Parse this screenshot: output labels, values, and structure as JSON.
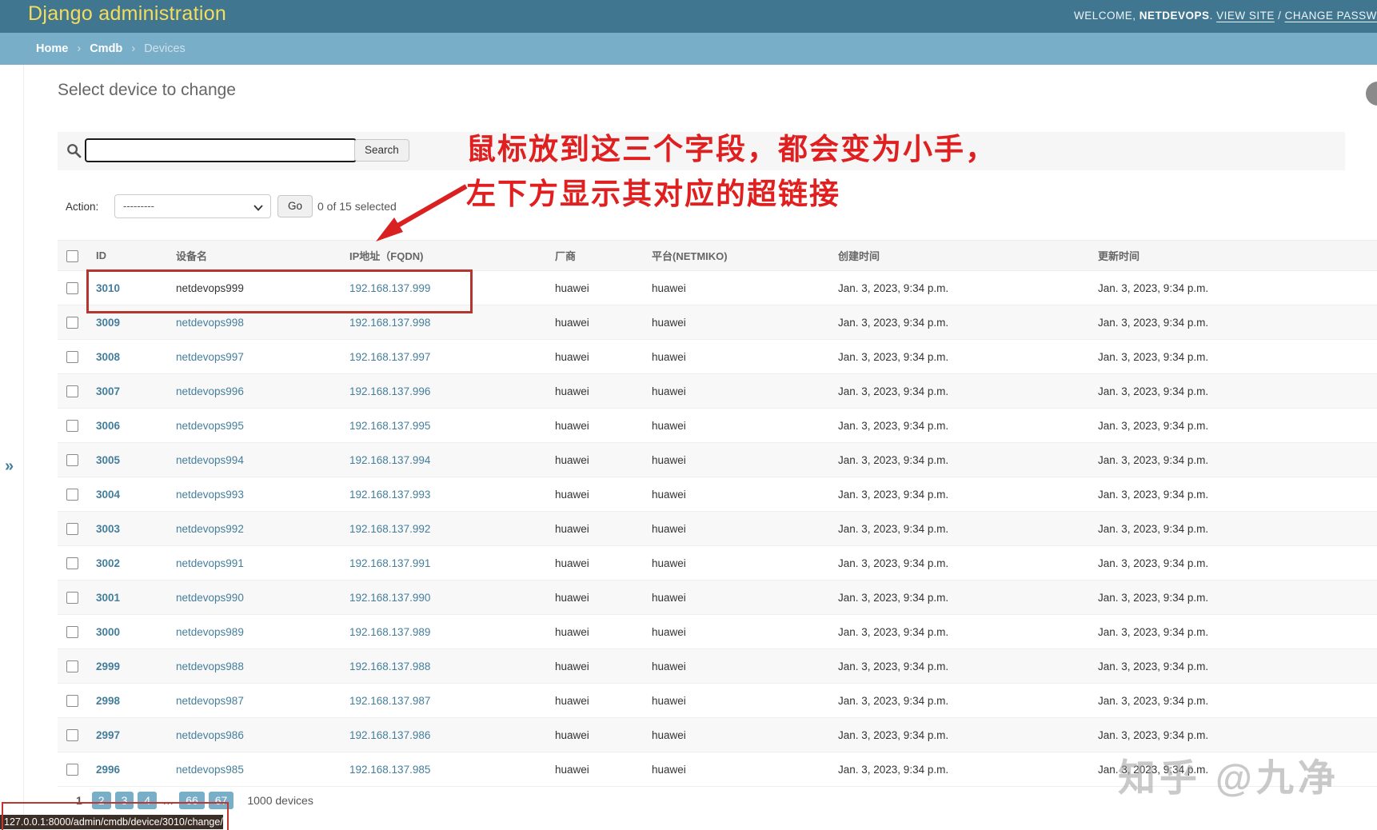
{
  "header": {
    "site_title": "Django administration",
    "welcome_text": "WELCOME,",
    "username": "NETDEVOPS",
    "after_username": ".",
    "view_site_link": "VIEW SITE",
    "link_separator": "/",
    "change_password_link": "CHANGE PASSWORD"
  },
  "breadcrumb": {
    "home": "Home",
    "cmdb": "Cmdb",
    "current": "Devices",
    "separator": "›"
  },
  "page_title": "Select device to change",
  "search": {
    "value": "",
    "placeholder": "",
    "button_label": "Search"
  },
  "actions": {
    "label": "Action:",
    "selected_option": "---------",
    "go_label": "Go",
    "selection_status": "0 of 15 selected"
  },
  "annotation": {
    "line1": "鼠标放到这三个字段，都会变为小手，",
    "line2": "左下方显示其对应的超链接"
  },
  "table": {
    "columns": {
      "id": "ID",
      "name": "设备名",
      "ip": "IP地址（FQDN)",
      "vendor": "厂商",
      "platform": "平台(NETMIKO)",
      "created": "创建时间",
      "updated": "更新时间"
    },
    "rows": [
      {
        "id": "3010",
        "name": "netdevops999",
        "ip": "192.168.137.999",
        "vendor": "huawei",
        "platform": "huawei",
        "created": "Jan. 3, 2023, 9:34 p.m.",
        "updated": "Jan. 3, 2023, 9:34 p.m."
      },
      {
        "id": "3009",
        "name": "netdevops998",
        "ip": "192.168.137.998",
        "vendor": "huawei",
        "platform": "huawei",
        "created": "Jan. 3, 2023, 9:34 p.m.",
        "updated": "Jan. 3, 2023, 9:34 p.m."
      },
      {
        "id": "3008",
        "name": "netdevops997",
        "ip": "192.168.137.997",
        "vendor": "huawei",
        "platform": "huawei",
        "created": "Jan. 3, 2023, 9:34 p.m.",
        "updated": "Jan. 3, 2023, 9:34 p.m."
      },
      {
        "id": "3007",
        "name": "netdevops996",
        "ip": "192.168.137.996",
        "vendor": "huawei",
        "platform": "huawei",
        "created": "Jan. 3, 2023, 9:34 p.m.",
        "updated": "Jan. 3, 2023, 9:34 p.m."
      },
      {
        "id": "3006",
        "name": "netdevops995",
        "ip": "192.168.137.995",
        "vendor": "huawei",
        "platform": "huawei",
        "created": "Jan. 3, 2023, 9:34 p.m.",
        "updated": "Jan. 3, 2023, 9:34 p.m."
      },
      {
        "id": "3005",
        "name": "netdevops994",
        "ip": "192.168.137.994",
        "vendor": "huawei",
        "platform": "huawei",
        "created": "Jan. 3, 2023, 9:34 p.m.",
        "updated": "Jan. 3, 2023, 9:34 p.m."
      },
      {
        "id": "3004",
        "name": "netdevops993",
        "ip": "192.168.137.993",
        "vendor": "huawei",
        "platform": "huawei",
        "created": "Jan. 3, 2023, 9:34 p.m.",
        "updated": "Jan. 3, 2023, 9:34 p.m."
      },
      {
        "id": "3003",
        "name": "netdevops992",
        "ip": "192.168.137.992",
        "vendor": "huawei",
        "platform": "huawei",
        "created": "Jan. 3, 2023, 9:34 p.m.",
        "updated": "Jan. 3, 2023, 9:34 p.m."
      },
      {
        "id": "3002",
        "name": "netdevops991",
        "ip": "192.168.137.991",
        "vendor": "huawei",
        "platform": "huawei",
        "created": "Jan. 3, 2023, 9:34 p.m.",
        "updated": "Jan. 3, 2023, 9:34 p.m."
      },
      {
        "id": "3001",
        "name": "netdevops990",
        "ip": "192.168.137.990",
        "vendor": "huawei",
        "platform": "huawei",
        "created": "Jan. 3, 2023, 9:34 p.m.",
        "updated": "Jan. 3, 2023, 9:34 p.m."
      },
      {
        "id": "3000",
        "name": "netdevops989",
        "ip": "192.168.137.989",
        "vendor": "huawei",
        "platform": "huawei",
        "created": "Jan. 3, 2023, 9:34 p.m.",
        "updated": "Jan. 3, 2023, 9:34 p.m."
      },
      {
        "id": "2999",
        "name": "netdevops988",
        "ip": "192.168.137.988",
        "vendor": "huawei",
        "platform": "huawei",
        "created": "Jan. 3, 2023, 9:34 p.m.",
        "updated": "Jan. 3, 2023, 9:34 p.m."
      },
      {
        "id": "2998",
        "name": "netdevops987",
        "ip": "192.168.137.987",
        "vendor": "huawei",
        "platform": "huawei",
        "created": "Jan. 3, 2023, 9:34 p.m.",
        "updated": "Jan. 3, 2023, 9:34 p.m."
      },
      {
        "id": "2997",
        "name": "netdevops986",
        "ip": "192.168.137.986",
        "vendor": "huawei",
        "platform": "huawei",
        "created": "Jan. 3, 2023, 9:34 p.m.",
        "updated": "Jan. 3, 2023, 9:34 p.m."
      },
      {
        "id": "2996",
        "name": "netdevops985",
        "ip": "192.168.137.985",
        "vendor": "huawei",
        "platform": "huawei",
        "created": "Jan. 3, 2023, 9:34 p.m.",
        "updated": "Jan. 3, 2023, 9:34 p.m."
      }
    ]
  },
  "pagination": {
    "pages": [
      {
        "label": "1",
        "type": "current"
      },
      {
        "label": "2",
        "type": "link"
      },
      {
        "label": "3",
        "type": "link"
      },
      {
        "label": "4",
        "type": "link"
      },
      {
        "label": "…",
        "type": "ellipsis"
      },
      {
        "label": "66",
        "type": "link"
      },
      {
        "label": "67",
        "type": "link"
      }
    ],
    "total_label": "1000 devices"
  },
  "status_bar": {
    "url": "127.0.0.1:8000/admin/cmdb/device/3010/change/"
  },
  "watermark": {
    "text": "知乎 @九净"
  },
  "sidebar": {
    "toggle_glyph": "»"
  },
  "colors": {
    "header_bg": "#417690",
    "breadcrumb_bg": "#79aec8",
    "title_yellow": "#f5dd5d",
    "link_blue": "#447e9b",
    "annotation_red": "#e02020",
    "pagebox_bg": "#79aec8",
    "status_bg": "#3b2e27"
  }
}
